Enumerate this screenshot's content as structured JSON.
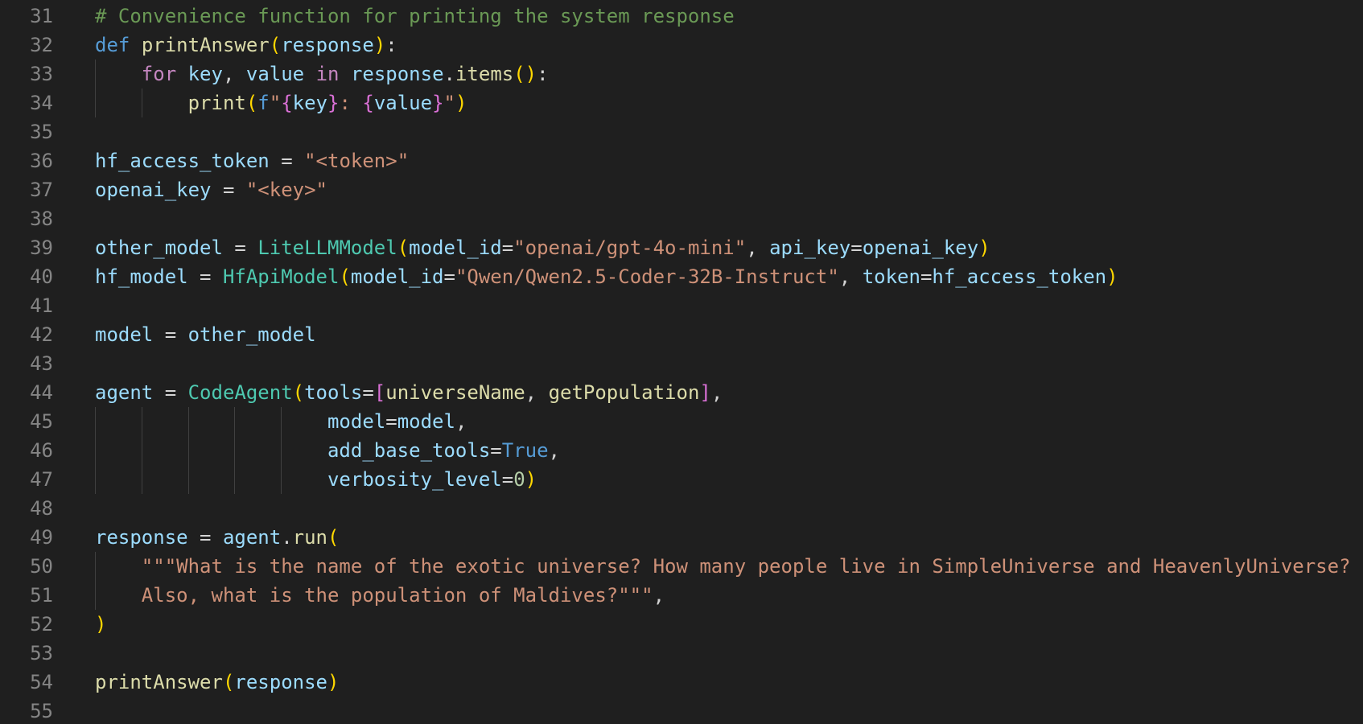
{
  "editor": {
    "language": "python",
    "colors": {
      "background": "#1f1f1f",
      "line_number": "#858585",
      "keyword": "#569cd6",
      "control_keyword": "#c586c0",
      "function": "#dcdcaa",
      "variable": "#9cdcfe",
      "class": "#4ec9b0",
      "string": "#ce9178",
      "comment": "#6a9955",
      "number": "#b5cea8",
      "bracket_level_1": "#ffd700",
      "bracket_level_2": "#da70d6"
    },
    "lines": [
      {
        "n": "31",
        "guides": 0,
        "tokens": [
          [
            "cmt",
            "# Convenience function for printing the system response"
          ]
        ]
      },
      {
        "n": "32",
        "guides": 0,
        "tokens": [
          [
            "kw-def",
            "def"
          ],
          [
            "op",
            " "
          ],
          [
            "fn",
            "printAnswer"
          ],
          [
            "p1",
            "("
          ],
          [
            "var",
            "response"
          ],
          [
            "p1",
            ")"
          ],
          [
            "op",
            ":"
          ]
        ]
      },
      {
        "n": "33",
        "guides": 1,
        "tokens": [
          [
            "op",
            "    "
          ],
          [
            "kw-ctl",
            "for"
          ],
          [
            "op",
            " "
          ],
          [
            "var",
            "key"
          ],
          [
            "op",
            ", "
          ],
          [
            "var",
            "value"
          ],
          [
            "op",
            " "
          ],
          [
            "kw-ctl",
            "in"
          ],
          [
            "op",
            " "
          ],
          [
            "var",
            "response"
          ],
          [
            "op",
            "."
          ],
          [
            "fn",
            "items"
          ],
          [
            "p1",
            "()"
          ],
          [
            "op",
            ":"
          ]
        ]
      },
      {
        "n": "34",
        "guides": 2,
        "tokens": [
          [
            "op",
            "        "
          ],
          [
            "fn",
            "print"
          ],
          [
            "p1",
            "("
          ],
          [
            "kw-def",
            "f"
          ],
          [
            "str",
            "\""
          ],
          [
            "p2",
            "{"
          ],
          [
            "var",
            "key"
          ],
          [
            "p2",
            "}"
          ],
          [
            "str",
            ": "
          ],
          [
            "p2",
            "{"
          ],
          [
            "var",
            "value"
          ],
          [
            "p2",
            "}"
          ],
          [
            "str",
            "\""
          ],
          [
            "p1",
            ")"
          ]
        ]
      },
      {
        "n": "35",
        "guides": 0,
        "tokens": []
      },
      {
        "n": "36",
        "guides": 0,
        "tokens": [
          [
            "var",
            "hf_access_token"
          ],
          [
            "op",
            " = "
          ],
          [
            "str",
            "\"<token>\""
          ]
        ]
      },
      {
        "n": "37",
        "guides": 0,
        "tokens": [
          [
            "var",
            "openai_key"
          ],
          [
            "op",
            " = "
          ],
          [
            "str",
            "\"<key>\""
          ]
        ]
      },
      {
        "n": "38",
        "guides": 0,
        "tokens": []
      },
      {
        "n": "39",
        "guides": 0,
        "tokens": [
          [
            "var",
            "other_model"
          ],
          [
            "op",
            " = "
          ],
          [
            "cls",
            "LiteLLMModel"
          ],
          [
            "p1",
            "("
          ],
          [
            "var",
            "model_id"
          ],
          [
            "op",
            "="
          ],
          [
            "str",
            "\"openai/gpt-4o-mini\""
          ],
          [
            "op",
            ", "
          ],
          [
            "var",
            "api_key"
          ],
          [
            "op",
            "="
          ],
          [
            "var",
            "openai_key"
          ],
          [
            "p1",
            ")"
          ]
        ]
      },
      {
        "n": "40",
        "guides": 0,
        "tokens": [
          [
            "var",
            "hf_model"
          ],
          [
            "op",
            " = "
          ],
          [
            "cls",
            "HfApiModel"
          ],
          [
            "p1",
            "("
          ],
          [
            "var",
            "model_id"
          ],
          [
            "op",
            "="
          ],
          [
            "str",
            "\"Qwen/Qwen2.5-Coder-32B-Instruct\""
          ],
          [
            "op",
            ", "
          ],
          [
            "var",
            "token"
          ],
          [
            "op",
            "="
          ],
          [
            "var",
            "hf_access_token"
          ],
          [
            "p1",
            ")"
          ]
        ]
      },
      {
        "n": "41",
        "guides": 0,
        "tokens": []
      },
      {
        "n": "42",
        "guides": 0,
        "tokens": [
          [
            "var",
            "model"
          ],
          [
            "op",
            " = "
          ],
          [
            "var",
            "other_model"
          ]
        ]
      },
      {
        "n": "43",
        "guides": 0,
        "tokens": []
      },
      {
        "n": "44",
        "guides": 0,
        "tokens": [
          [
            "var",
            "agent"
          ],
          [
            "op",
            " = "
          ],
          [
            "cls",
            "CodeAgent"
          ],
          [
            "p1",
            "("
          ],
          [
            "var",
            "tools"
          ],
          [
            "op",
            "="
          ],
          [
            "p2",
            "["
          ],
          [
            "fn",
            "universeName"
          ],
          [
            "op",
            ", "
          ],
          [
            "fn",
            "getPopulation"
          ],
          [
            "p2",
            "]"
          ],
          [
            "op",
            ","
          ]
        ]
      },
      {
        "n": "45",
        "guides": 5,
        "tokens": [
          [
            "op",
            "                    "
          ],
          [
            "var",
            "model"
          ],
          [
            "op",
            "="
          ],
          [
            "var",
            "model"
          ],
          [
            "op",
            ","
          ]
        ]
      },
      {
        "n": "46",
        "guides": 5,
        "tokens": [
          [
            "op",
            "                    "
          ],
          [
            "var",
            "add_base_tools"
          ],
          [
            "op",
            "="
          ],
          [
            "const",
            "True"
          ],
          [
            "op",
            ","
          ]
        ]
      },
      {
        "n": "47",
        "guides": 5,
        "tokens": [
          [
            "op",
            "                    "
          ],
          [
            "var",
            "verbosity_level"
          ],
          [
            "op",
            "="
          ],
          [
            "num",
            "0"
          ],
          [
            "p1",
            ")"
          ]
        ]
      },
      {
        "n": "48",
        "guides": 0,
        "tokens": []
      },
      {
        "n": "49",
        "guides": 0,
        "tokens": [
          [
            "var",
            "response"
          ],
          [
            "op",
            " = "
          ],
          [
            "var",
            "agent"
          ],
          [
            "op",
            "."
          ],
          [
            "fn",
            "run"
          ],
          [
            "p1",
            "("
          ]
        ]
      },
      {
        "n": "50",
        "guides": 1,
        "tokens": [
          [
            "op",
            "    "
          ],
          [
            "str",
            "\"\"\"What is the name of the exotic universe? How many people live in SimpleUniverse and HeavenlyUniverse?"
          ]
        ]
      },
      {
        "n": "51",
        "guides": 1,
        "tokens": [
          [
            "op",
            "    "
          ],
          [
            "str",
            "Also, what is the population of Maldives?\"\"\""
          ],
          [
            "op",
            ","
          ]
        ]
      },
      {
        "n": "52",
        "guides": 0,
        "tokens": [
          [
            "p1",
            ")"
          ]
        ]
      },
      {
        "n": "53",
        "guides": 0,
        "tokens": []
      },
      {
        "n": "54",
        "guides": 0,
        "tokens": [
          [
            "fn",
            "printAnswer"
          ],
          [
            "p1",
            "("
          ],
          [
            "var",
            "response"
          ],
          [
            "p1",
            ")"
          ]
        ]
      },
      {
        "n": "55",
        "guides": 0,
        "tokens": []
      }
    ]
  }
}
